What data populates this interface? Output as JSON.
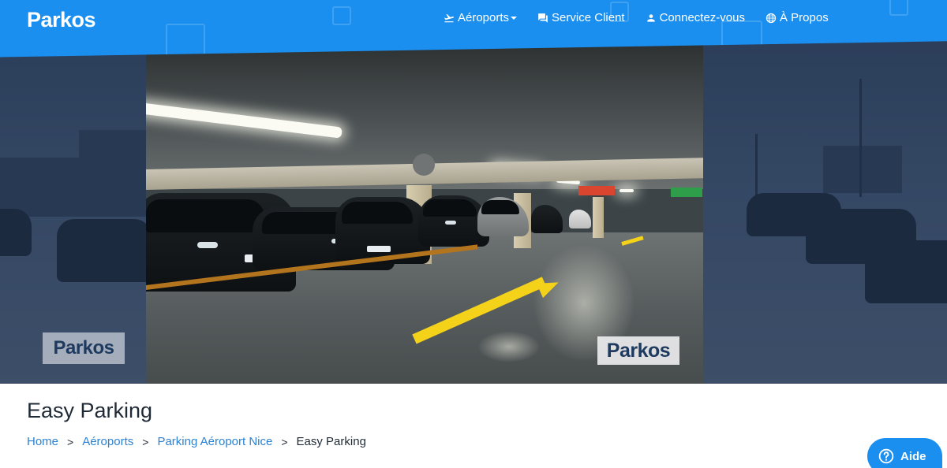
{
  "header": {
    "logo": "Parkos",
    "nav": [
      {
        "label": "Aéroports",
        "icon": "plane-takeoff-icon",
        "has_dropdown": true
      },
      {
        "label": "Service Client",
        "icon": "chat-icon",
        "has_dropdown": false
      },
      {
        "label": "Connectez-vous",
        "icon": "user-icon",
        "has_dropdown": false
      },
      {
        "label": "À Propos",
        "icon": "globe-icon",
        "has_dropdown": false
      }
    ]
  },
  "hero": {
    "watermark": "Parkos",
    "description_icon": "parking-garage-photo"
  },
  "page": {
    "title": "Easy Parking"
  },
  "breadcrumb": {
    "items": [
      {
        "label": "Home",
        "link": true
      },
      {
        "label": "Aéroports",
        "link": true
      },
      {
        "label": "Parking Aéroport Nice",
        "link": true
      },
      {
        "label": "Easy Parking",
        "link": false
      }
    ],
    "separator": ">"
  },
  "help": {
    "label": "Aide",
    "icon": "question-circle-icon"
  },
  "colors": {
    "brand_blue": "#1a8ff0",
    "link_blue": "#2b82d6",
    "text_dark": "#1f2a36",
    "arrow_yellow": "#f5d21a"
  }
}
